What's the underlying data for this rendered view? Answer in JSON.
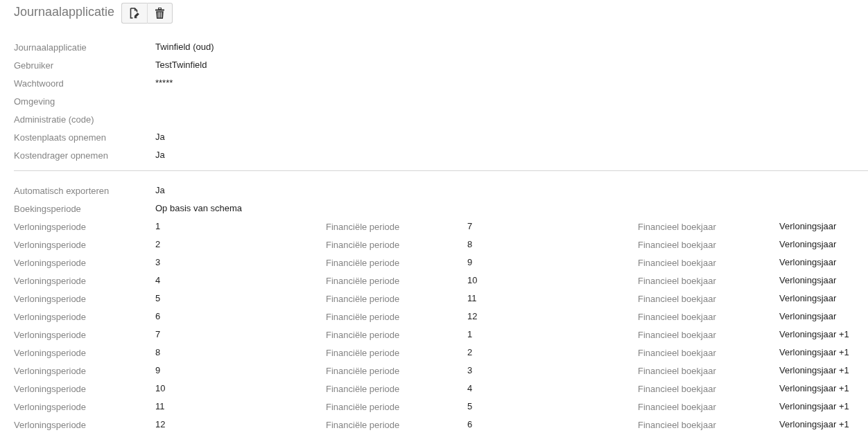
{
  "header": {
    "title": "Journaalapplicatie",
    "buttons": [
      {
        "kind": "edit"
      },
      {
        "kind": "delete"
      }
    ]
  },
  "details": [
    {
      "label": "Journaalapplicatie",
      "value": "Twinfield (oud)"
    },
    {
      "label": "Gebruiker",
      "value": "TestTwinfield"
    },
    {
      "label": "Wachtwoord",
      "value": "*****"
    },
    {
      "label": "Omgeving"
    },
    {
      "label": "Administratie (code)"
    },
    {
      "label": "Kostenplaats opnemen",
      "value": "Ja"
    },
    {
      "label": "Kostendrager opnemen",
      "value": "Ja"
    }
  ],
  "export_settings": [
    {
      "label": "Automatisch exporteren",
      "value": "Ja"
    },
    {
      "label": "Boekingsperiode",
      "value": "Op basis van schema"
    }
  ],
  "period_mapping": [
    {
      "payroll_label": "Verloningsperiode",
      "payroll_period": "1",
      "financial_label": "Financiële periode",
      "financial_period": "7",
      "year_label": "Financieel boekjaar",
      "year_value": "Verloningsjaar"
    },
    {
      "payroll_label": "Verloningsperiode",
      "payroll_period": "2",
      "financial_label": "Financiële periode",
      "financial_period": "8",
      "year_label": "Financieel boekjaar",
      "year_value": "Verloningsjaar"
    },
    {
      "payroll_label": "Verloningsperiode",
      "payroll_period": "3",
      "financial_label": "Financiële periode",
      "financial_period": "9",
      "year_label": "Financieel boekjaar",
      "year_value": "Verloningsjaar"
    },
    {
      "payroll_label": "Verloningsperiode",
      "payroll_period": "4",
      "financial_label": "Financiële periode",
      "financial_period": "10",
      "year_label": "Financieel boekjaar",
      "year_value": "Verloningsjaar"
    },
    {
      "payroll_label": "Verloningsperiode",
      "payroll_period": "5",
      "financial_label": "Financiële periode",
      "financial_period": "11",
      "year_label": "Financieel boekjaar",
      "year_value": "Verloningsjaar"
    },
    {
      "payroll_label": "Verloningsperiode",
      "payroll_period": "6",
      "financial_label": "Financiële periode",
      "financial_period": "12",
      "year_label": "Financieel boekjaar",
      "year_value": "Verloningsjaar"
    },
    {
      "payroll_label": "Verloningsperiode",
      "payroll_period": "7",
      "financial_label": "Financiële periode",
      "financial_period": "1",
      "year_label": "Financieel boekjaar",
      "year_value": "Verloningsjaar +1"
    },
    {
      "payroll_label": "Verloningsperiode",
      "payroll_period": "8",
      "financial_label": "Financiële periode",
      "financial_period": "2",
      "year_label": "Financieel boekjaar",
      "year_value": "Verloningsjaar +1"
    },
    {
      "payroll_label": "Verloningsperiode",
      "payroll_period": "9",
      "financial_label": "Financiële periode",
      "financial_period": "3",
      "year_label": "Financieel boekjaar",
      "year_value": "Verloningsjaar +1"
    },
    {
      "payroll_label": "Verloningsperiode",
      "payroll_period": "10",
      "financial_label": "Financiële periode",
      "financial_period": "4",
      "year_label": "Financieel boekjaar",
      "year_value": "Verloningsjaar +1"
    },
    {
      "payroll_label": "Verloningsperiode",
      "payroll_period": "11",
      "financial_label": "Financiële periode",
      "financial_period": "5",
      "year_label": "Financieel boekjaar",
      "year_value": "Verloningsjaar +1"
    },
    {
      "payroll_label": "Verloningsperiode",
      "payroll_period": "12",
      "financial_label": "Financiële periode",
      "financial_period": "6",
      "year_label": "Financieel boekjaar",
      "year_value": "Verloningsjaar +1"
    }
  ]
}
